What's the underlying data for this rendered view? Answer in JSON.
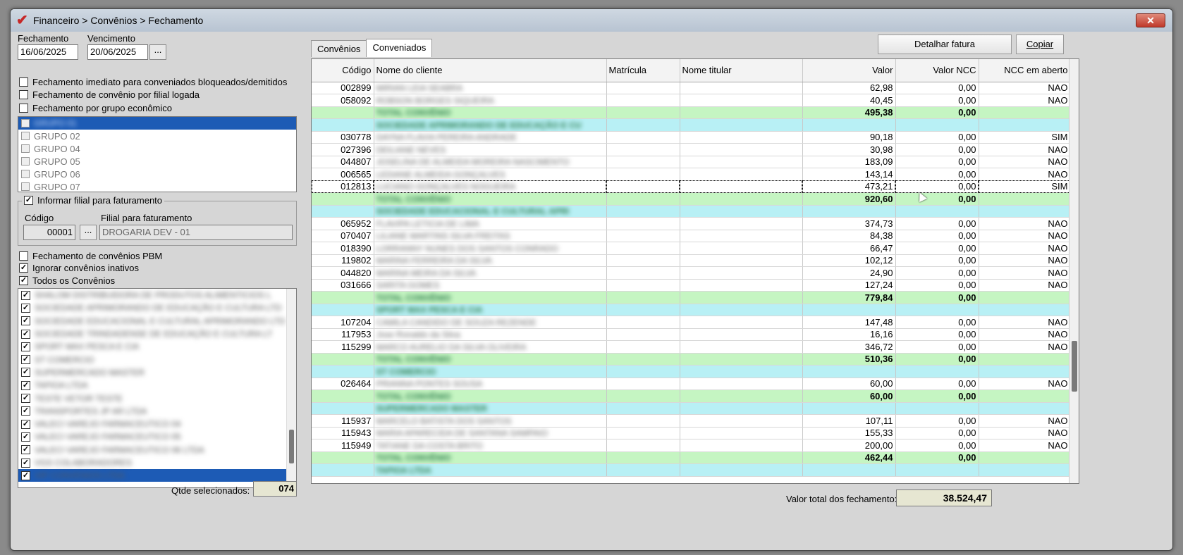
{
  "window": {
    "title": "Financeiro > Convênios > Fechamento",
    "close_label": "✕"
  },
  "dates": {
    "fechamento_label": "Fechamento",
    "fechamento_value": "16/06/2025",
    "vencimento_label": "Vencimento",
    "vencimento_value": "20/06/2025",
    "picker_label": "..."
  },
  "options": {
    "imediato": "Fechamento imediato para conveniados bloqueados/demitidos",
    "filial_logada": "Fechamento de convênio por filial logada",
    "grupo_economico": "Fechamento por grupo econômico"
  },
  "groups": [
    "GRUPO 01",
    "GRUPO 02",
    "GRUPO 04",
    "GRUPO 05",
    "GRUPO 06",
    "GRUPO 07"
  ],
  "filial": {
    "check_label": "Informar filial para faturamento",
    "codigo_label": "Código",
    "codigo_value": "00001",
    "picker_label": "...",
    "filial_label": "Filial para faturamento",
    "filial_value": "DROGARIA DEV - 01"
  },
  "options2": {
    "pbm": "Fechamento de convênios PBM",
    "ignorar": "Ignorar convênios inativos",
    "todos": "Todos os Convênios"
  },
  "convenios": [
    "SHALOM DISTRIBUIDORA DE PRODUTOS ALIMENTICIOS L",
    "SOCIEDADE APRIMORANDO DE EDUCAÇÃO E CULTURA LTD",
    "SOCIEDADE EDUCACIONAL E CULTURAL APRIMORANDO LTD",
    "SOCIEDADE TRINDADENSE DE EDUCAÇÃO E CULTURA LT",
    "SPORT MAX PESCA E CIA",
    "ST COMERCIO",
    "SUPERMERCADO MASTER",
    "TAPIOA LTDA",
    "TESTE VETOR TESTE",
    "TRANSPORTES JP AR LTDA",
    "VALECI VAREJO FARMACEUTICO 04",
    "VALECI VAREJO FARMACEUTICO 05",
    "VALECI VAREJO FARMACEUTICO 06 LTDA",
    "VGS COLABORADORES",
    "VIP CONVENIOS LTDA"
  ],
  "qtde": {
    "label": "Qtde selecionados:",
    "value": "074"
  },
  "tabs": [
    "Convênios",
    "Conveniados"
  ],
  "buttons": {
    "detalhar": "Detalhar fatura",
    "copiar": "Copiar"
  },
  "grid": {
    "headers": [
      "Código",
      "Nome do cliente",
      "Matrícula",
      "Nome titular",
      "Valor",
      "Valor NCC",
      "NCC em aberto"
    ],
    "rows": [
      {
        "type": "data",
        "codigo": "002899",
        "nome": "MIRIAN LEIA SEABRA",
        "valor": "62,98",
        "ncc": "0,00",
        "aberto": "NAO"
      },
      {
        "type": "data",
        "codigo": "058092",
        "nome": "ROBSON BORGES SIQUEIRA",
        "valor": "40,45",
        "ncc": "0,00",
        "aberto": "NAO"
      },
      {
        "type": "total",
        "codigo": "",
        "nome": "TOTAL CONVÊNIO",
        "valor": "495,38",
        "ncc": "0,00",
        "aberto": ""
      },
      {
        "type": "group",
        "codigo": "",
        "nome": "SOCIEDADE APRIMORANDO DE EDUCAÇÃO E CU",
        "valor": "",
        "ncc": "",
        "aberto": ""
      },
      {
        "type": "data",
        "codigo": "030778",
        "nome": "DAYNA FLAVIA PEREIRA ANDRADE",
        "valor": "90,18",
        "ncc": "0,00",
        "aberto": "SIM"
      },
      {
        "type": "data",
        "codigo": "027396",
        "nome": "DEILIANE NEVES",
        "valor": "30,98",
        "ncc": "0,00",
        "aberto": "NAO"
      },
      {
        "type": "data",
        "codigo": "044807",
        "nome": "JOSELINA DE ALMEIDA MOREIRA NASCIMENTO",
        "valor": "183,09",
        "ncc": "0,00",
        "aberto": "NAO"
      },
      {
        "type": "data",
        "codigo": "006565",
        "nome": "LEDIANE ALMEIDA GONÇALVES",
        "valor": "143,14",
        "ncc": "0,00",
        "aberto": "NAO"
      },
      {
        "type": "data",
        "codigo": "012813",
        "nome": "LUCIANO GONÇALVES NOGUEIRA",
        "valor": "473,21",
        "ncc": "0,00",
        "aberto": "SIM",
        "focus": true
      },
      {
        "type": "total",
        "codigo": "",
        "nome": "TOTAL CONVÊNIO",
        "valor": "920,60",
        "ncc": "0,00",
        "aberto": ""
      },
      {
        "type": "group",
        "codigo": "",
        "nome": "SOCIEDADE EDUCACIONAL E CULTURAL APRI",
        "valor": "",
        "ncc": "",
        "aberto": ""
      },
      {
        "type": "data",
        "codigo": "065952",
        "nome": "FLAVIPA LETICIA DE LIMA",
        "valor": "374,73",
        "ncc": "0,00",
        "aberto": "NAO"
      },
      {
        "type": "data",
        "codigo": "070407",
        "nome": "LILIANE MARTINS SILVA FREITAS",
        "valor": "84,38",
        "ncc": "0,00",
        "aberto": "NAO"
      },
      {
        "type": "data",
        "codigo": "018390",
        "nome": "LORRANNY NUNES DOS SANTOS CONRADO",
        "valor": "66,47",
        "ncc": "0,00",
        "aberto": "NAO"
      },
      {
        "type": "data",
        "codigo": "119802",
        "nome": "MARINA FERREIRA DA SILVA",
        "valor": "102,12",
        "ncc": "0,00",
        "aberto": "NAO"
      },
      {
        "type": "data",
        "codigo": "044820",
        "nome": "MARINA MEIRA DA SILVA",
        "valor": "24,90",
        "ncc": "0,00",
        "aberto": "NAO"
      },
      {
        "type": "data",
        "codigo": "031666",
        "nome": "SARITA GOMES",
        "valor": "127,24",
        "ncc": "0,00",
        "aberto": "NAO"
      },
      {
        "type": "total",
        "codigo": "",
        "nome": "TOTAL CONVÊNIO",
        "valor": "779,84",
        "ncc": "0,00",
        "aberto": ""
      },
      {
        "type": "group",
        "codigo": "",
        "nome": "SPORT MAX PESCA E CIA",
        "valor": "",
        "ncc": "",
        "aberto": ""
      },
      {
        "type": "data",
        "codigo": "107204",
        "nome": "CAMILA CANDIDO DE SOUZA REZENDE",
        "valor": "147,48",
        "ncc": "0,00",
        "aberto": "NAO"
      },
      {
        "type": "data",
        "codigo": "117953",
        "nome": "Jose Ronaldo da Silva",
        "valor": "16,16",
        "ncc": "0,00",
        "aberto": "NAO"
      },
      {
        "type": "data",
        "codigo": "115299",
        "nome": "MARCO AURELIO DA SILVA OLIVEIRA",
        "valor": "346,72",
        "ncc": "0,00",
        "aberto": "NAO"
      },
      {
        "type": "total",
        "codigo": "",
        "nome": "TOTAL CONVÊNIO",
        "valor": "510,36",
        "ncc": "0,00",
        "aberto": ""
      },
      {
        "type": "group",
        "codigo": "",
        "nome": "ST COMERCIO",
        "valor": "",
        "ncc": "",
        "aberto": ""
      },
      {
        "type": "data",
        "codigo": "026464",
        "nome": "PRIANNA PONTES SOUSA",
        "valor": "60,00",
        "ncc": "0,00",
        "aberto": "NAO"
      },
      {
        "type": "total",
        "codigo": "",
        "nome": "TOTAL CONVÊNIO",
        "valor": "60,00",
        "ncc": "0,00",
        "aberto": ""
      },
      {
        "type": "group",
        "codigo": "",
        "nome": "SUPERMERCADO MASTER",
        "valor": "",
        "ncc": "",
        "aberto": ""
      },
      {
        "type": "data",
        "codigo": "115937",
        "nome": "MARCELO BATISTA DOS SANTOS",
        "valor": "107,11",
        "ncc": "0,00",
        "aberto": "NAO"
      },
      {
        "type": "data",
        "codigo": "115943",
        "nome": "MARIA APARECIDA DE SANTANA SAMPAIO",
        "valor": "155,33",
        "ncc": "0,00",
        "aberto": "NAO"
      },
      {
        "type": "data",
        "codigo": "115949",
        "nome": "TATIANE DA COSTA BRITO",
        "valor": "200,00",
        "ncc": "0,00",
        "aberto": "NAO"
      },
      {
        "type": "total",
        "codigo": "",
        "nome": "TOTAL CONVÊNIO",
        "valor": "462,44",
        "ncc": "0,00",
        "aberto": ""
      },
      {
        "type": "group",
        "codigo": "",
        "nome": "TAPIOA LTDA",
        "valor": "",
        "ncc": "",
        "aberto": ""
      }
    ]
  },
  "total": {
    "label": "Valor total dos fechamento:",
    "value": "38.524,47"
  },
  "colors": {
    "total_row": "#c5f5c2",
    "group_row": "#b8f0f5",
    "selection": "#1d5bb5"
  }
}
